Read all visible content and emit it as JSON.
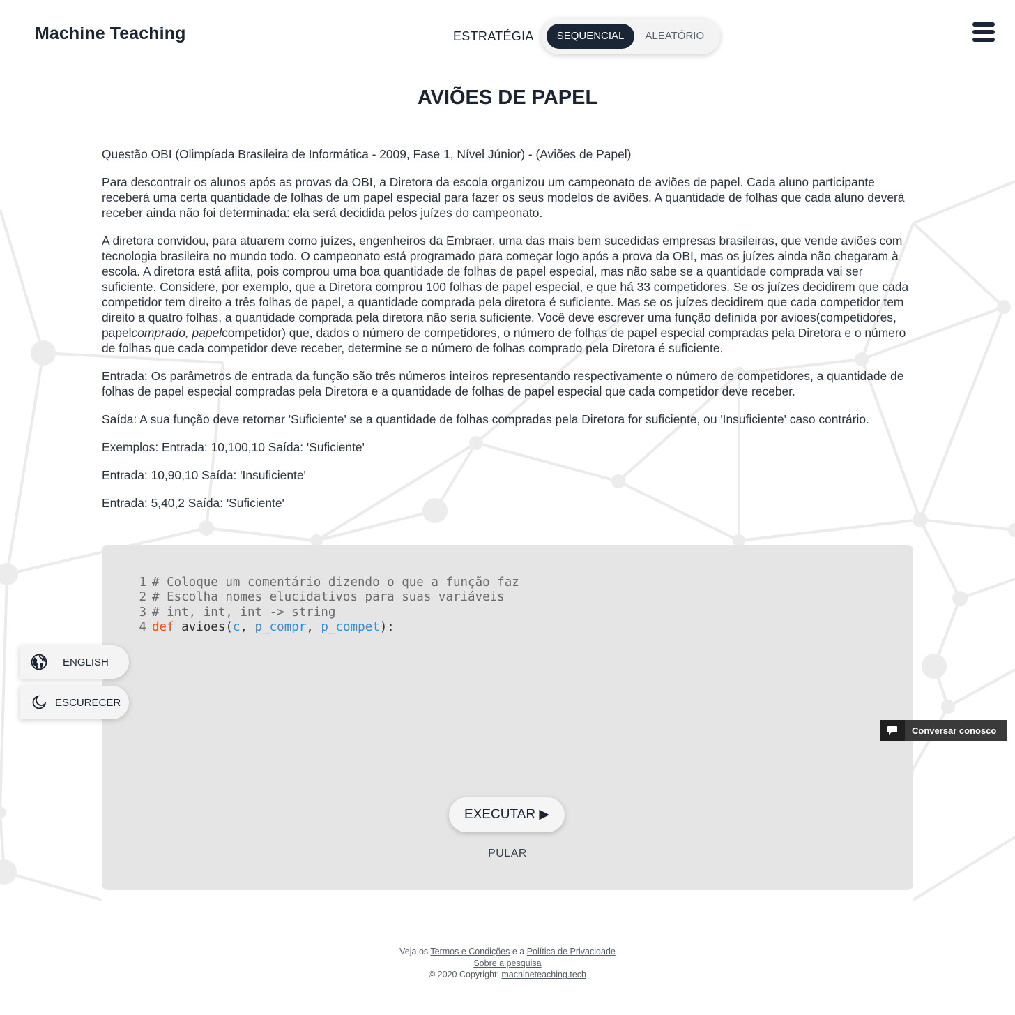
{
  "header": {
    "logo": "Machine Teaching",
    "strategy_label": "ESTRATÉGIA",
    "strategy_options": [
      "SEQUENCIAL",
      "ALEATÓRIO"
    ],
    "strategy_selected": "SEQUENCIAL",
    "menu_icon": "hamburger-menu-icon"
  },
  "problem": {
    "title": "AVIÕES DE PAPEL",
    "paragraphs": [
      "Questão OBI (Olimpíada Brasileira de Informática - 2009, Fase 1, Nível Júnior) - (Aviões de Papel)",
      "Para descontrair os alunos após as provas da OBI, a Diretora da escola organizou um campeonato de aviões de papel. Cada aluno participante receberá uma certa quantidade de folhas de um papel especial para fazer os seus modelos de aviões. A quantidade de folhas que cada aluno deverá receber ainda não foi determinada: ela será decidida pelos juízes do campeonato.",
      "A diretora convidou, para atuarem como juízes, engenheiros da Embraer, uma das mais bem sucedidas empresas brasileiras, que vende aviões com tecnologia brasileira no mundo todo. O campeonato está programado para começar logo após a prova da OBI, mas os juízes ainda não chegaram à escola. A diretora está aflita, pois comprou uma boa quantidade de folhas de papel especial, mas não sabe se a quantidade comprada vai ser suficiente. Considere, por exemplo, que a Diretora comprou 100 folhas de papel especial, e que há 33 competidores. Se os juízes decidirem que cada competidor tem direito a três folhas de papel, a quantidade comprada pela diretora é suficiente. Mas se os juízes decidirem que cada competidor tem direito a quatro folhas, a quantidade comprada pela diretora não seria suficiente. Você deve escrever uma função definida por avioes(competidores, papel",
      "Entrada: Os parâmetros de entrada da função são três números inteiros representando respectivamente o número de competidores, a quantidade de folhas de papel especial compradas pela Diretora e a quantidade de folhas de papel especial que cada competidor deve receber.",
      "Saída: A sua função deve retornar 'Suficiente' se a quantidade de folhas compradas pela Diretora for suficiente, ou 'Insuficiente' caso contrário.",
      "Exemplos: Entrada: 10,100,10 Saída: 'Suficiente'",
      "Entrada: 10,90,10 Saída: 'Insuficiente'",
      "Entrada: 5,40,2 Saída: 'Suficiente'"
    ],
    "p3_italic": "comprado, papel",
    "p3_tail": "competidor) que, dados o número de competidores, o número de folhas de papel especial compradas pela Diretora e o número de folhas que cada competidor deve receber, determine se o número de folhas comprado pela Diretora é suficiente."
  },
  "editor": {
    "line_numbers": [
      "1",
      "2",
      "3",
      "4"
    ],
    "comments": [
      "# Coloque um comentário dizendo o que a função faz",
      "# Escolha nomes elucidativos para suas variáveis",
      "# int, int, int -> string"
    ],
    "def_keyword": "def",
    "func_name": "avioes",
    "open_paren": "(",
    "params": [
      "c",
      "p_compr",
      "p_compet"
    ],
    "sep": ", ",
    "close": "):",
    "run_label": "EXECUTAR ▶",
    "skip_label": "PULAR"
  },
  "side": {
    "english_label": "ENGLISH",
    "english_icon": "globe-icon",
    "dark_label": "ESCURECER",
    "dark_icon": "moon-icon"
  },
  "chat": {
    "label": "Conversar conosco",
    "icon": "chat-bubble-icon"
  },
  "footer": {
    "prefix": "Veja os ",
    "terms": "Termos e Condições",
    "mid": " e a ",
    "privacy": "Política de Privacidade",
    "about": "Sobre a pesquisa",
    "copyright": "© 2020 Copyright: ",
    "site": "machineteaching.tech"
  },
  "colors": {
    "accent_dark": "#1a2535",
    "keyword": "#e0531a",
    "param": "#2f8ee0",
    "editor_bg": "#e4e4e4"
  }
}
